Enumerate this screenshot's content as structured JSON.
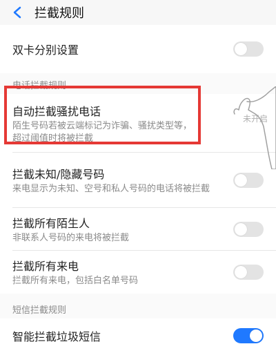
{
  "header": {
    "title": "拦截规则"
  },
  "dual_sim": {
    "label": "双卡分别设置",
    "toggle_on": false
  },
  "sections": {
    "call_rules_title": "电话拦截规则",
    "sms_rules_title": "短信拦截规则"
  },
  "auto_block": {
    "label": "自动拦截骚扰电话",
    "desc": "陌生号码若被云端标记为诈骗、骚扰类型等，超过阈值时将被拦截",
    "status": "未开启"
  },
  "unknown_hidden": {
    "label": "拦截未知/隐藏号码",
    "desc": "来电显示为未知、空号和私人号码的电话将被拦截",
    "toggle_on": false
  },
  "all_strangers": {
    "label": "拦截所有陌生人",
    "desc": "非联系人号码的来电将被拦截",
    "toggle_on": false
  },
  "all_calls": {
    "label": "拦截所有来电",
    "desc": "拦截所有来电，包括白名单号码",
    "toggle_on": false
  },
  "smart_sms": {
    "label": "智能拦截垃圾短信",
    "toggle_on": true
  },
  "colors": {
    "accent": "#1f79ff",
    "highlight": "#e53935"
  }
}
